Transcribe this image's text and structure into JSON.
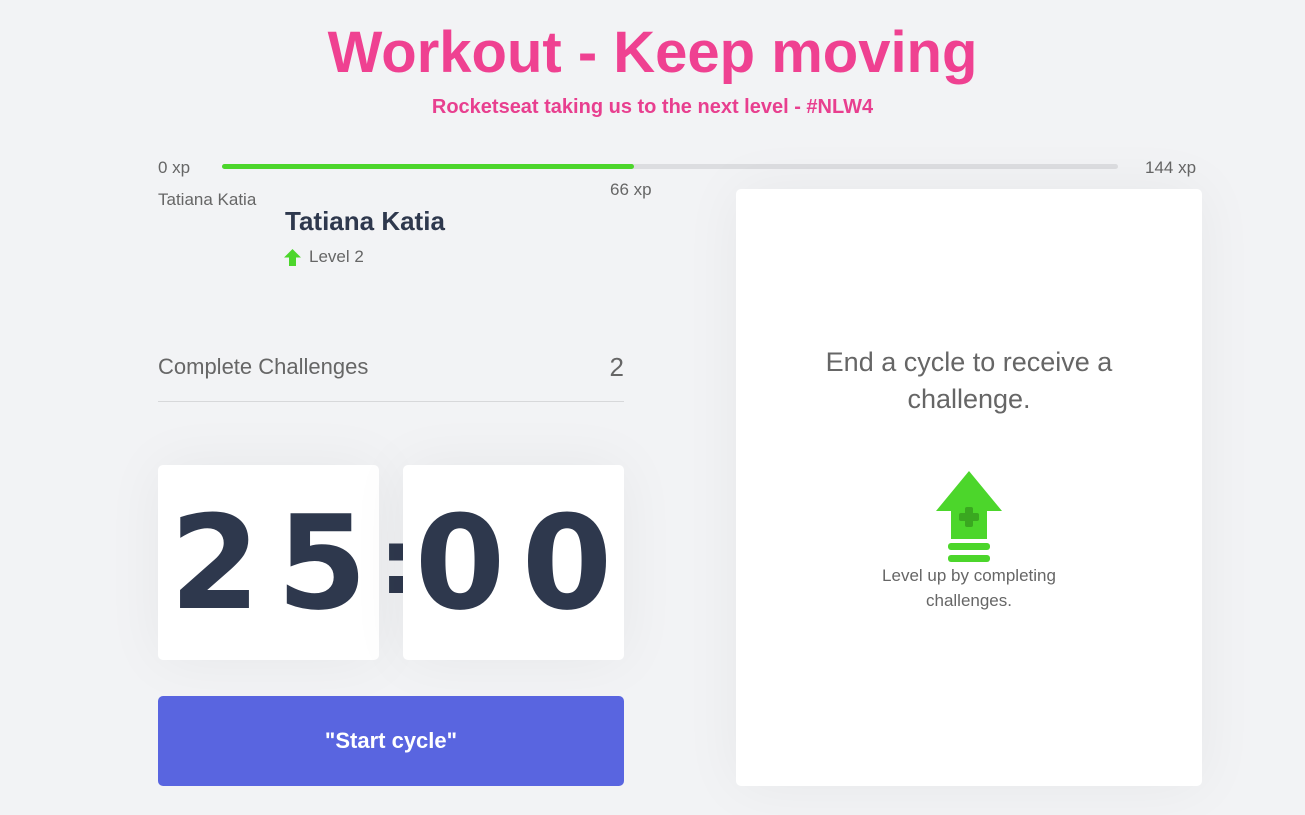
{
  "header": {
    "title": "Workout - Keep moving",
    "subtitle": "Rocketseat taking us to the next level - #NLW4"
  },
  "experience_bar": {
    "start_label": "0 xp",
    "end_label": "144 xp",
    "current_label": "66 xp",
    "progress_fraction": 0.46
  },
  "profile": {
    "avatar_alt": "Tatiana Katia",
    "name": "Tatiana Katia",
    "level_label": "Level 2",
    "level_icon": "level-up-arrow-icon"
  },
  "challenges_completed": {
    "label": "Complete Challenges",
    "count": "2"
  },
  "countdown": {
    "minute_left": "2",
    "minute_right": "5",
    "separator": ":",
    "second_left": "0",
    "second_right": "0"
  },
  "start_button": {
    "label": "\"Start cycle\""
  },
  "challenge_box": {
    "heading": "End a cycle to receive a challenge.",
    "icon": "level-up-icon",
    "hint": "Level up by completing challenges."
  },
  "colors": {
    "title_pink": "#ef4191",
    "progress_green": "#4cd62b",
    "button_blue": "#5965e0",
    "text_dark": "#2e384d",
    "background": "#f2f3f5"
  }
}
